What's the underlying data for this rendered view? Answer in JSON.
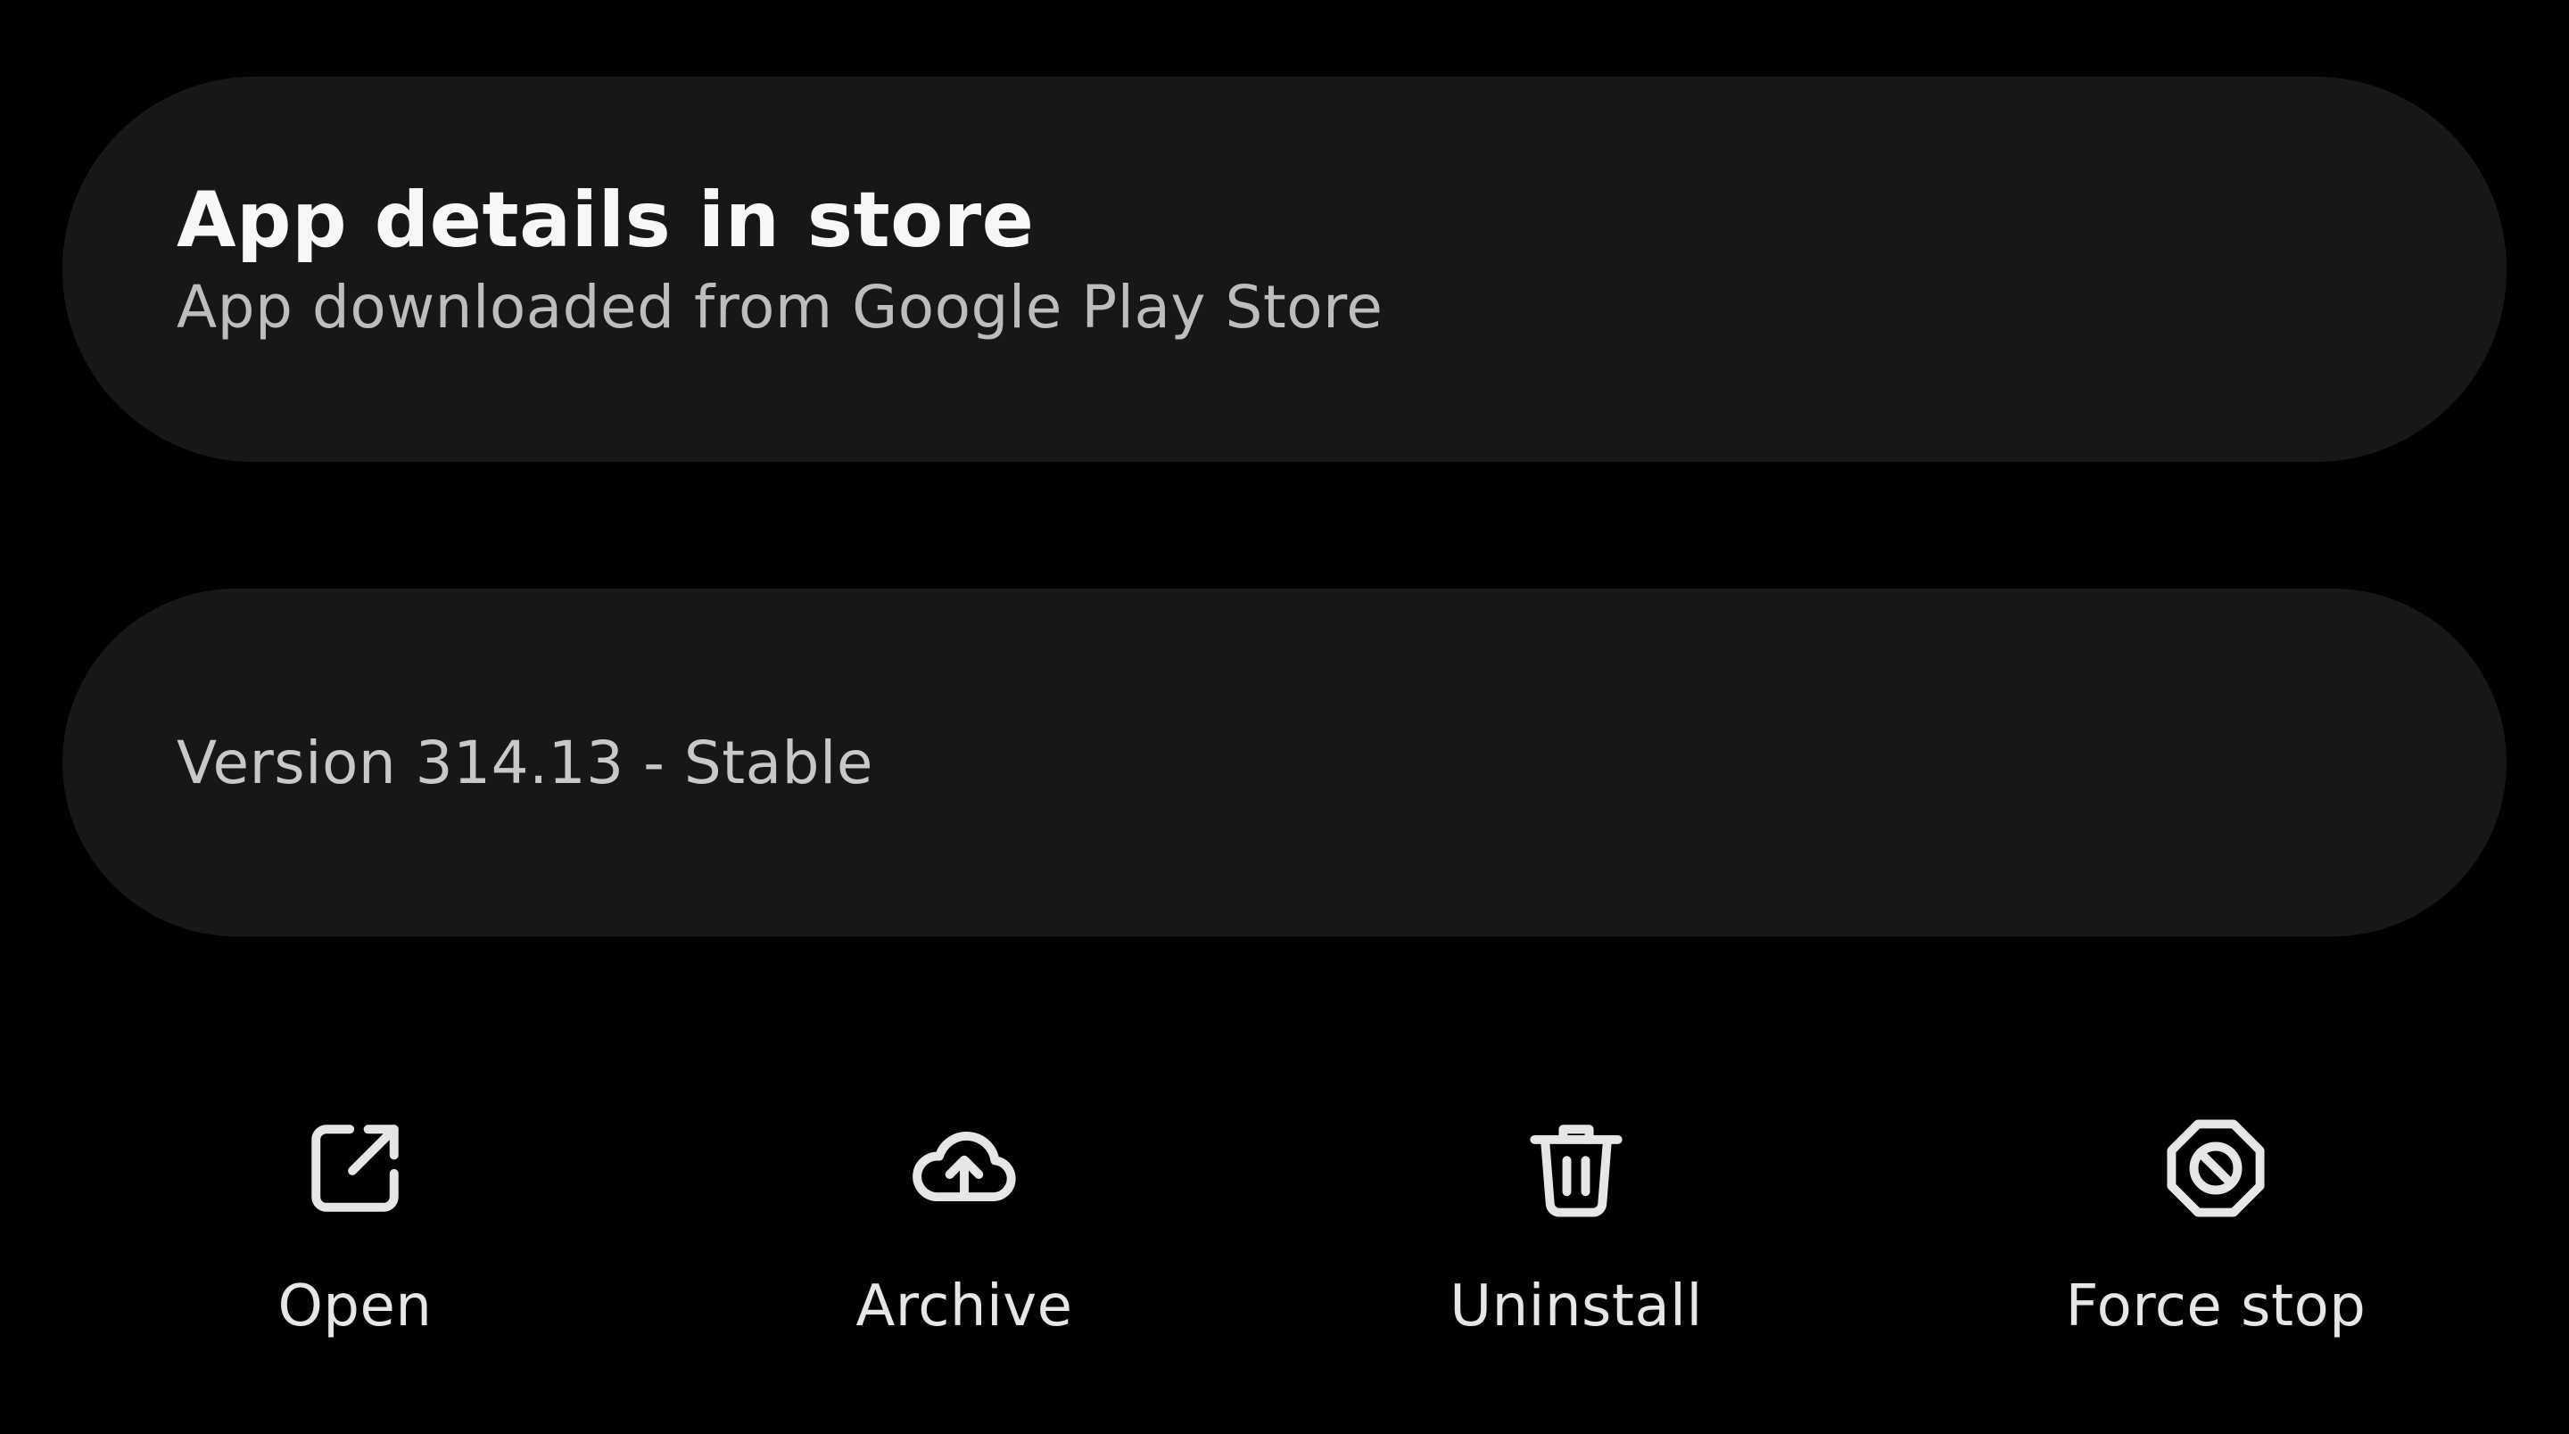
{
  "store_card": {
    "title": "App details in store",
    "subtitle": "App downloaded from Google Play Store"
  },
  "version_card": {
    "text": "Version 314.13 - Stable"
  },
  "actions": [
    {
      "label": "Open",
      "icon": "open-external-icon"
    },
    {
      "label": "Archive",
      "icon": "cloud-upload-icon"
    },
    {
      "label": "Uninstall",
      "icon": "trash-icon"
    },
    {
      "label": "Force stop",
      "icon": "block-icon"
    }
  ],
  "colors": {
    "background": "#000000",
    "card": "#171717",
    "title_text": "#f7f7f7",
    "secondary_text": "#bdbdbd"
  }
}
